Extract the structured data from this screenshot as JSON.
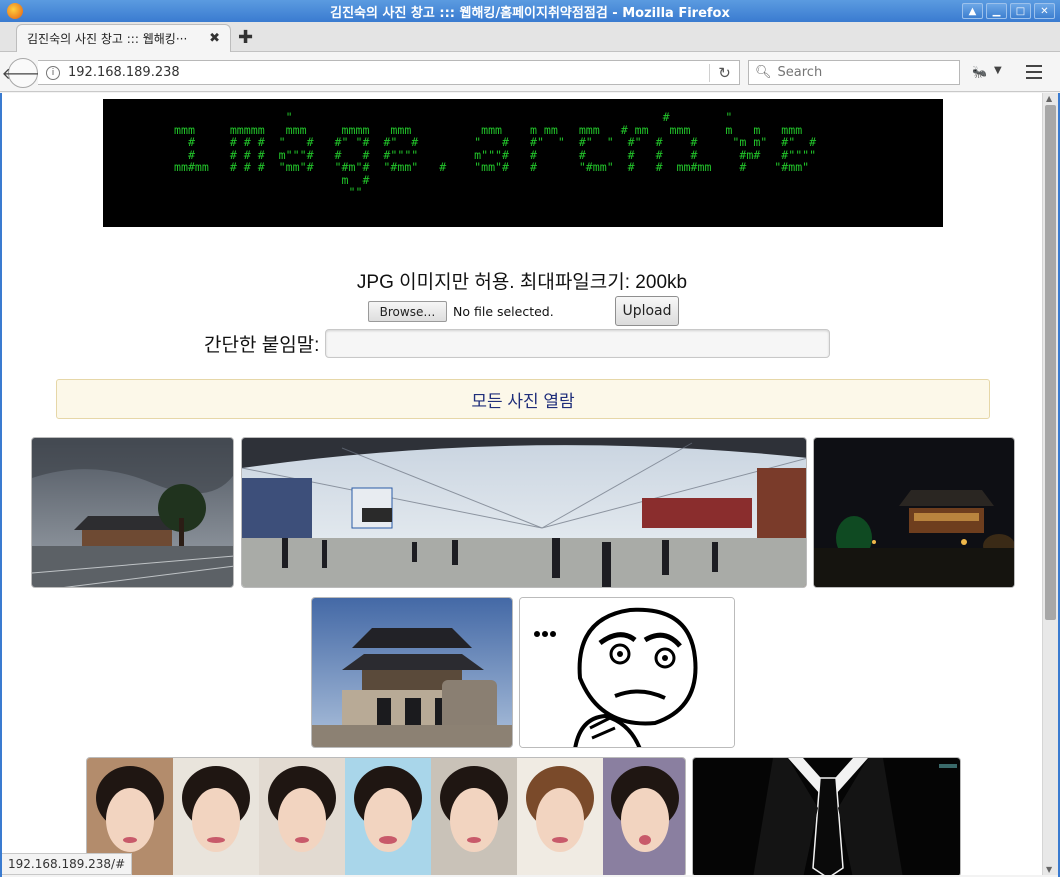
{
  "window": {
    "title": "김진숙의 사진 창고 ::: 웹해킹/홈페이지취약점점검 - Mozilla Firefox"
  },
  "tab": {
    "title": "김진숙의 사진 창고 ::: 웹해킹···",
    "close": "✖",
    "new_tab": "✚"
  },
  "nav": {
    "url": "192.168.189.238",
    "search_placeholder": "Search"
  },
  "page": {
    "banner_ascii": "                 \"                                                     #        \"\n mmm     mmmmm   mmm     mmmm   mmm          mmm    m mm   mmm   # mm   mmm     m   m   mmm\n   #     # # #  \"   #   #\" \"#  #\"  #        \"   #   #\"  \"  #\"  \"  #\"  #    #     \"m m\"  #\"  #\n   #     # # #  m\"\"\"#   #   #  #\"\"\"\"        m\"\"\"#   #      #      #   #    #      #m#   #\"\"\"\"\n mm#mm   # # #  \"mm\"#   \"#m\"#  \"#mm\"   #    \"mm\"#   #      \"#mm\"  #   #  mm#mm    #    \"#mm\"\n                         m  #\n                          \"\"",
    "notice": "JPG 이미지만 허용. 최대파일크기: 200kb",
    "browse_label": "Browse…",
    "file_status": "No file selected.",
    "upload_label": "Upload",
    "caption_label": "간단한 붙임말:",
    "view_all": "모든 사진 열람"
  },
  "status": {
    "link": "192.168.189.238/#"
  },
  "colors": {
    "banner_bg": "#000000",
    "banner_text": "#22c42a",
    "viewall_bg": "#fcf8e9",
    "viewall_text": "#1f2e7a"
  }
}
